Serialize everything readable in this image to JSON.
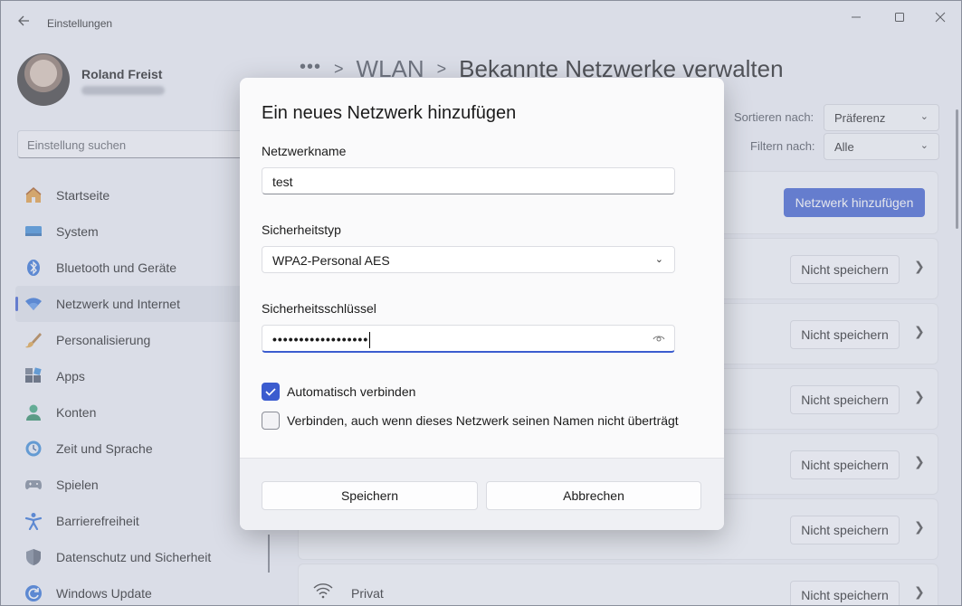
{
  "window": {
    "title": "Einstellungen",
    "controls": [
      "minimize-icon",
      "maximize-icon",
      "close-icon"
    ]
  },
  "profile": {
    "name": "Roland Freist"
  },
  "search": {
    "placeholder": "Einstellung suchen"
  },
  "sidebar": {
    "items": [
      {
        "label": "Startseite",
        "icon": "home-icon"
      },
      {
        "label": "System",
        "icon": "monitor-icon"
      },
      {
        "label": "Bluetooth und Geräte",
        "icon": "bluetooth-icon"
      },
      {
        "label": "Netzwerk und Internet",
        "icon": "wifi-icon",
        "active": true
      },
      {
        "label": "Personalisierung",
        "icon": "brush-icon"
      },
      {
        "label": "Apps",
        "icon": "apps-icon"
      },
      {
        "label": "Konten",
        "icon": "person-icon"
      },
      {
        "label": "Zeit und Sprache",
        "icon": "clock-globe-icon"
      },
      {
        "label": "Spielen",
        "icon": "gamepad-icon"
      },
      {
        "label": "Barrierefreiheit",
        "icon": "accessibility-icon"
      },
      {
        "label": "Datenschutz und Sicherheit",
        "icon": "shield-icon"
      },
      {
        "label": "Windows Update",
        "icon": "update-icon"
      }
    ]
  },
  "breadcrumb": {
    "dots": "•••",
    "level1": "WLAN",
    "current": "Bekannte Netzwerke verwalten"
  },
  "filters": {
    "sort_label": "Sortieren nach:",
    "sort_value": "Präferenz",
    "filter_label": "Filtern nach:",
    "filter_value": "Alle"
  },
  "add_network_button": "Netzwerk hinzufügen",
  "networks": {
    "forget_label": "Nicht speichern",
    "rows": [
      {
        "name": ""
      },
      {
        "name": ""
      },
      {
        "name": ""
      },
      {
        "name": ""
      },
      {
        "name": ""
      },
      {
        "name": "Privat"
      }
    ]
  },
  "dialog": {
    "title": "Ein neues Netzwerk hinzufügen",
    "network_name_label": "Netzwerkname",
    "network_name_value": "test",
    "security_type_label": "Sicherheitstyp",
    "security_type_value": "WPA2-Personal AES",
    "security_key_label": "Sicherheitsschlüssel",
    "security_key_value": "••••••••••••••••••",
    "auto_connect_label": "Automatisch verbinden",
    "auto_connect_checked": true,
    "hidden_connect_label": "Verbinden, auch wenn dieses Netzwerk seinen Namen nicht überträgt",
    "hidden_connect_checked": false,
    "save_button": "Speichern",
    "cancel_button": "Abbrechen"
  },
  "colors": {
    "accent": "#3b5ccf",
    "window_bg": "#eef0f6",
    "dialog_bg": "#fafafb"
  }
}
